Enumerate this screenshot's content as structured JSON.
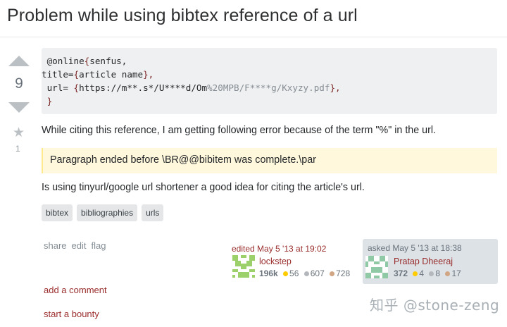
{
  "question": {
    "title": "Problem while using bibtex reference of a url",
    "score": "9",
    "favorites": "1"
  },
  "code": {
    "line1_prefix": " @online",
    "line1_brace": "{",
    "line1_rest": "senfus,",
    "line2_prefix": "title=",
    "line2_brace": "{",
    "line2_rest": "article name",
    "line2_close": "},",
    "line3_prefix": " url= ",
    "line3_brace": "{",
    "line3_a": "https://m**.s*/U****d/Om",
    "line3_b": "%20MPB/F****g/Kxyzy.pdf",
    "line3_close": "},",
    "line4": " }"
  },
  "body": {
    "paragraph1": "While citing this reference, I am getting following error because of the term \"%\" in the url.",
    "quote": "Paragraph ended before \\BR@@bibitem was complete.\\par",
    "paragraph2": "Is using tinyurl/google url shortener a good idea for citing the article's url."
  },
  "tags": [
    "bibtex",
    "bibliographies",
    "urls"
  ],
  "post_menu": {
    "share": "share",
    "edit": "edit",
    "flag": "flag"
  },
  "comments": {
    "add_comment": "add a comment",
    "bounty": "start a bounty"
  },
  "editor": {
    "action": "edited May 5 '13 at 19:02",
    "name": "lockstep",
    "reputation": "196k",
    "gold": "56",
    "silver": "607",
    "bronze": "728"
  },
  "asker": {
    "action": "asked May 5 '13 at 18:38",
    "name": "Pratap Dheeraj",
    "reputation": "372",
    "gold": "4",
    "silver": "8",
    "bronze": "17"
  },
  "watermark": "知乎 @stone-zeng",
  "colors": {
    "gold": "#ffcc01",
    "silver": "#b4b8bc",
    "bronze": "#d1a684",
    "link": "#9a2c2c"
  },
  "icons": {
    "upvote": "triangle-up",
    "downvote": "triangle-down",
    "favorite": "star-icon"
  }
}
